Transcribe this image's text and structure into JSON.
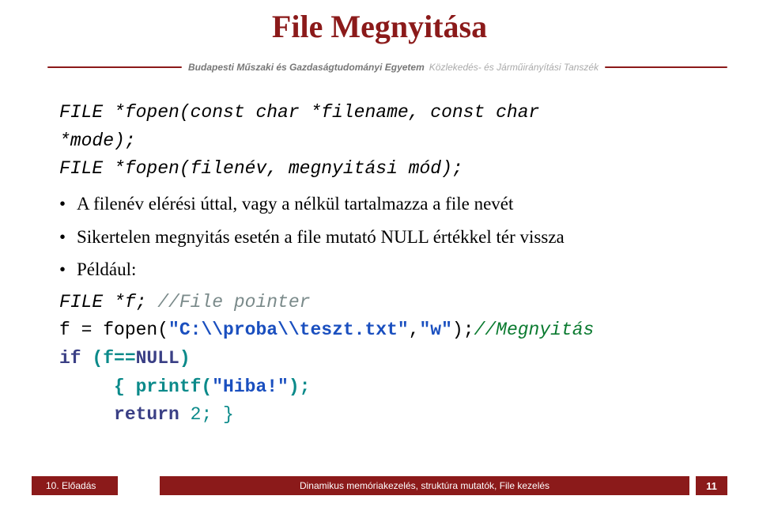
{
  "title": "File Megnyitása",
  "header": {
    "university": "Budapesti Műszaki és Gazdaságtudományi Egyetem",
    "department": "Közlekedés- és Járműirányítási Tanszék"
  },
  "signature1": "FILE *fopen(const char *filename, const char",
  "signature1b": "*mode);",
  "signature2a": "FILE *fopen",
  "signature2b": "(filenév, megnyitási mód);",
  "bullets": [
    "A filenév elérési úttal, vagy a nélkül tartalmazza a file nevét",
    "Sikertelen megnyitás esetén a file mutató NULL értékkel tér vissza",
    "Például:"
  ],
  "example": {
    "l1a": "FILE *f; ",
    "l1b": "//File pointer",
    "l2a": "f = fopen(",
    "l2b": "\"C:\\\\proba\\\\teszt.txt\"",
    "l2c": ",",
    "l2d": "\"w\"",
    "l2e": ");",
    "l2f": "//Megnyitás",
    "l3a": "if",
    "l3b": " (f==",
    "l3c": "NULL",
    "l3d": ")",
    "l4a": "     { printf(",
    "l4b": "\"Hiba!\"",
    "l4c": ");",
    "l5a": "     ",
    "l5b": "return",
    "l5c": " 2; }"
  },
  "footer": {
    "left": "10. Előadás",
    "center": "Dinamikus memóriakezelés, struktúra mutatók, File kezelés",
    "page": "11"
  }
}
